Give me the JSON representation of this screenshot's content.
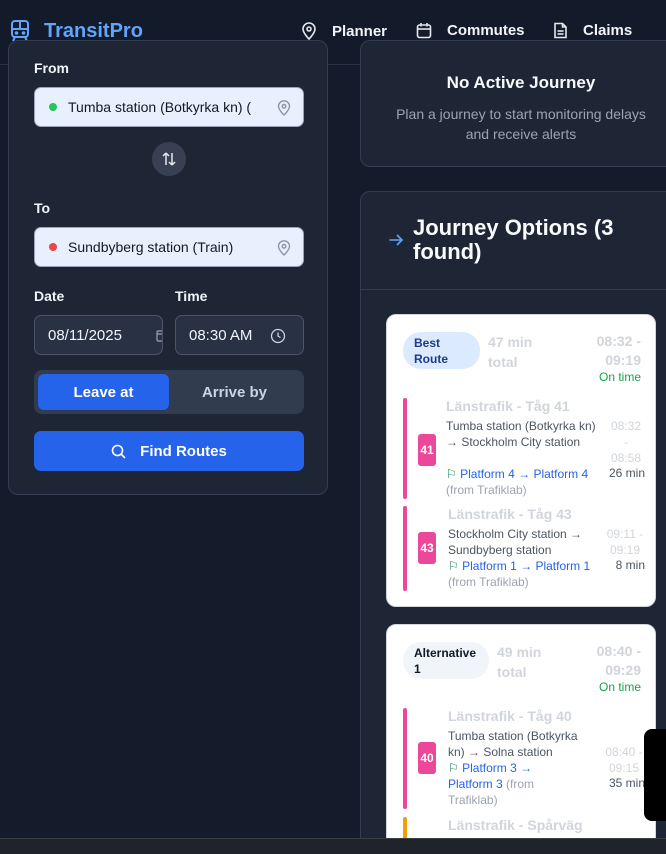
{
  "header": {
    "brand": "TransitPro",
    "nav": [
      {
        "label": "Planner",
        "icon": "map-pin-icon"
      },
      {
        "label": "Commutes",
        "icon": "calendar-icon"
      },
      {
        "label": "Claims",
        "icon": "document-icon"
      }
    ]
  },
  "form": {
    "from_label": "From",
    "from_value": "Tumba station (Botkyrka kn) (",
    "to_label": "To",
    "to_value": "Sundbyberg station (Train)",
    "date_label": "Date",
    "date_value": "08/11/2025",
    "time_label": "Time",
    "time_value": "08:30 AM",
    "leave_at": "Leave at",
    "arrive_by": "Arrive by",
    "find_routes": "Find Routes",
    "colors": {
      "from_dot": "#22c55e",
      "to_dot": "#ef4444",
      "primary": "#2563eb"
    }
  },
  "active": {
    "title": "No Active Journey",
    "subtitle": "Plan a journey to start monitoring delays and receive alerts"
  },
  "options": {
    "title": "Journey Options (3 found)",
    "routes": [
      {
        "badge": "Best Route",
        "total": "47 min total",
        "time_window": "08:32 - 09:19",
        "status": "On time",
        "legs": [
          {
            "line": "41",
            "name": "Länstrafik - Tåg 41",
            "path": "Tumba station (Botkyrka kn) → Stockholm City station",
            "platform": "Platform 4 → Platform 4",
            "source": "(from Trafiklab)",
            "dep": "08:32",
            "arr": "08:58",
            "duration": "26 min"
          },
          {
            "line": "43",
            "name": "Länstrafik - Tåg 43",
            "path": "Stockholm City station → Sundbyberg station",
            "platform": "Platform 1 → Platform 1",
            "source": "(from Trafiklab)",
            "dep": "09:11",
            "arr": "09:19",
            "duration": "8 min"
          }
        ]
      },
      {
        "badge": "Alternative 1",
        "total": "49 min total",
        "time_window": "08:40 - 09:29",
        "status": "On time",
        "legs": [
          {
            "line": "40",
            "name": "Länstrafik - Tåg 40",
            "path": "Tumba station (Botkyrka kn) → Solna station",
            "platform": "Platform 3 → Platform 3",
            "source": "(from Trafiklab)",
            "dep": "08:40",
            "arr": "09:15",
            "duration": "35 min"
          },
          {
            "name": "Länstrafik - Spårväg"
          }
        ]
      }
    ]
  }
}
